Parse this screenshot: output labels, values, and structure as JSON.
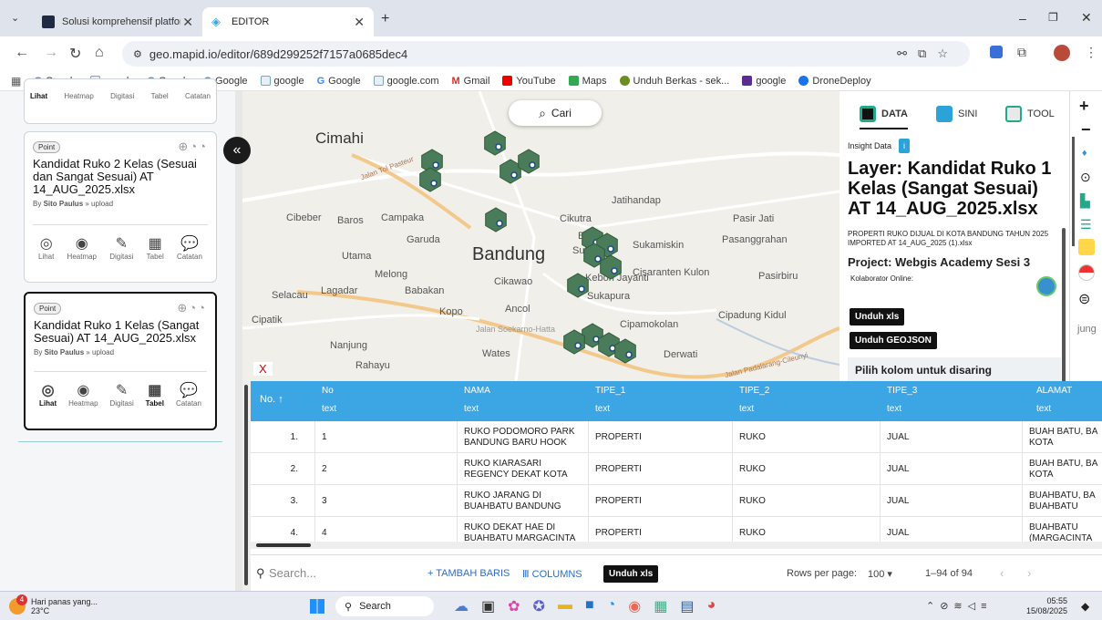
{
  "browser": {
    "tabs": [
      {
        "label": "Solusi komprehensif platform A"
      },
      {
        "label": "EDITOR"
      }
    ],
    "url": "geo.mapid.io/editor/689d299252f7157a0685dec4",
    "bookmarks": [
      "Google",
      "google",
      "Google",
      "Google",
      "google",
      "Google",
      "google.com",
      "Gmail",
      "YouTube",
      "Maps",
      "Unduh Berkas - sek...",
      "google",
      "DroneDeploy"
    ]
  },
  "sidebar": {
    "top_tools": [
      "Lihat",
      "Heatmap",
      "Digitasi",
      "Tabel",
      "Catatan"
    ],
    "cards": [
      {
        "type": "Point",
        "title": "Kandidat Ruko 2 Kelas (Sesuai dan Sangat Sesuai) AT 14_AUG_2025.xlsx",
        "by_label": "By",
        "author": "Sito Paulus",
        "source": "upload"
      },
      {
        "type": "Point",
        "title": "Kandidat Ruko 1 Kelas (Sangat Sesuai) AT 14_AUG_2025.xlsx",
        "by_label": "By",
        "author": "Sito Paulus",
        "source": "upload"
      }
    ],
    "tools": [
      "Lihat",
      "Heatmap",
      "Digitasi",
      "Tabel",
      "Catatan"
    ]
  },
  "map": {
    "search_label": "Cari",
    "places": [
      "Cimahi",
      "Jalan Tol Pasteur",
      "Jatihandap",
      "Cibeber",
      "Baros",
      "Campaka",
      "Cikutra",
      "Pasir Jati",
      "Garuda",
      "Utama",
      "Bandung",
      "Sukamiskin",
      "Pasanggrahan",
      "Melong",
      "Cikawao",
      "Cisaranten Kulon",
      "Pasirbiru",
      "Selacau",
      "Lagadar",
      "Babakan",
      "Sukapura",
      "Cipatik",
      "Kopo",
      "Ancol",
      "Cipadung Kidul",
      "Jalan Soekarno-Hatta",
      "Cipamokolan",
      "Nanjung",
      "Wates",
      "Derwati",
      "Rahayu",
      "Jalan Padalarang-Cileunyi",
      "Kebon Jayanti",
      "Suka",
      "Ba"
    ],
    "close_label": "X"
  },
  "panel": {
    "tabs": [
      "DATA",
      "SINI",
      "TOOL"
    ],
    "insight_label": "Insight Data",
    "insight_badge": "i",
    "layer_title": "Layer: Kandidat Ruko 1 Kelas (Sangat Sesuai) AT 14_AUG_2025.xlsx",
    "subtitle": "PROPERTI RUKO DIJUAL DI KOTA BANDUNG TAHUN 2025 IMPORTED AT 14_AUG_2025 (1).xlsx",
    "project": "Project: Webgis Academy Sesi 3",
    "collab": "Kolaborator Online:",
    "btn_xls": "Unduh xls",
    "btn_geojson": "Unduh GEOJSON",
    "filter_label": "Pilih kolom untuk disaring",
    "edge_text": "jung"
  },
  "table": {
    "columns": [
      {
        "name": "No.",
        "type": "",
        "sort": "↑"
      },
      {
        "name": "No",
        "type": "text"
      },
      {
        "name": "NAMA",
        "type": "text"
      },
      {
        "name": "TIPE_1",
        "type": "text"
      },
      {
        "name": "TIPE_2",
        "type": "text"
      },
      {
        "name": "TIPE_3",
        "type": "text"
      },
      {
        "name": "ALAMAT",
        "type": "text"
      }
    ],
    "rows": [
      [
        "1.",
        "1",
        "RUKO PODOMORO PARK BANDUNG BARU HOOK",
        "PROPERTI",
        "RUKO",
        "JUAL",
        "BUAH BATU, BA KOTA"
      ],
      [
        "2.",
        "2",
        "RUKO KIARASARI REGENCY DEKAT KOTA",
        "PROPERTI",
        "RUKO",
        "JUAL",
        "BUAH BATU, BA KOTA"
      ],
      [
        "3.",
        "3",
        "RUKO JARANG DI BUAHBATU BANDUNG",
        "PROPERTI",
        "RUKO",
        "JUAL",
        "BUAHBATU, BA BUAHBATU"
      ],
      [
        "4.",
        "4",
        "RUKO DEKAT HAE DI BUAHBATU MARGACINTA",
        "PROPERTI",
        "RUKO",
        "JUAL",
        "BUAHBATU (MARGACINTA"
      ]
    ],
    "search_placeholder": "Search...",
    "add_row": "+ TAMBAH BARIS",
    "columns_btn": "COLUMNS",
    "download": "Unduh xls",
    "rows_per_page_label": "Rows per page:",
    "rows_per_page": "100",
    "range": "1–94 of 94"
  },
  "taskbar": {
    "weather_badge": "4",
    "weather_text": "Hari panas yang...",
    "temp": "23°C",
    "search": "Search",
    "time": "05:55",
    "date": "15/08/2025"
  },
  "colors": {
    "accent": "#3ca5e3",
    "hex_marker": "#4a7c59"
  }
}
